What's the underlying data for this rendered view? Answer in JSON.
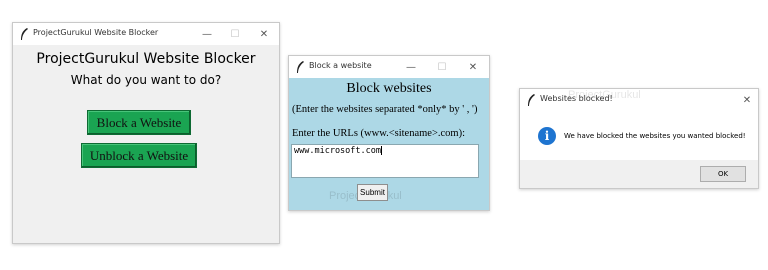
{
  "windows": [
    {
      "title": "ProjectGurukul Website Blocker",
      "heading": "ProjectGurukul Website Blocker",
      "prompt": "What do you want to do?",
      "buttons": {
        "block": "Block a Website",
        "unblock": "Unblock a Website"
      },
      "button_color": "#1aa452",
      "controls": {
        "minimize": "—",
        "maximize": "☐",
        "close": "✕"
      }
    },
    {
      "title": "Block a website",
      "heading": "Block websites",
      "instructions": "(Enter the websites separated *only* by ' , ')",
      "url_label": "Enter the URLs (www.<sitename>.com):",
      "url_value": "www.microsoft.com",
      "submit_label": "Submit",
      "background_color": "#add8e6",
      "controls": {
        "minimize": "—",
        "maximize": "☐",
        "close": "✕"
      }
    },
    {
      "title": "Websites blocked!",
      "message": "We have blocked the websites you wanted blocked!",
      "icon": "info-icon",
      "ok_label": "OK",
      "controls": {
        "close": "✕"
      }
    }
  ],
  "watermark": "ProjectGurukul"
}
